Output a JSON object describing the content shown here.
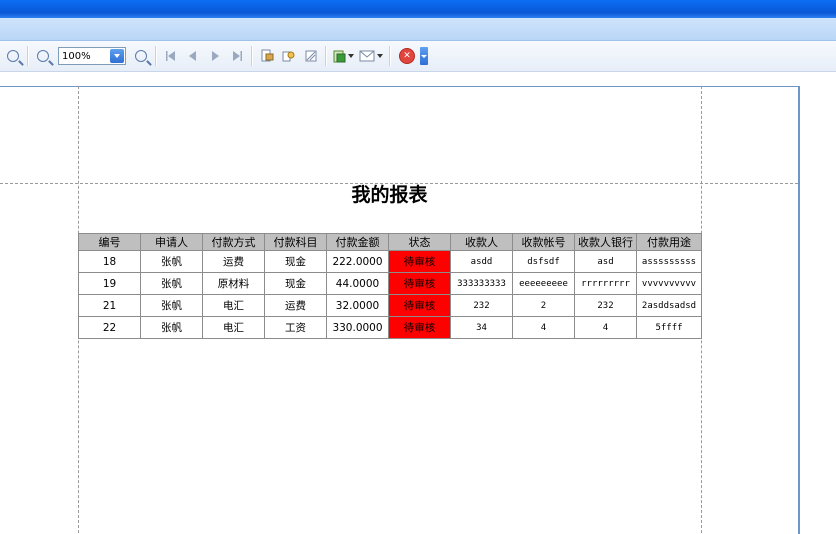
{
  "toolbar": {
    "zoom_value": "100%",
    "icons": [
      "zoom-in-icon",
      "zoom-out-icon",
      "zoom-in-icon",
      "first-page-icon",
      "prev-page-icon",
      "next-page-icon",
      "last-page-icon",
      "page-setup-icon",
      "find-icon",
      "fit-page-icon",
      "export-icon",
      "email-icon",
      "close-icon"
    ]
  },
  "report": {
    "title": "我的报表",
    "columns": [
      "编号",
      "申请人",
      "付款方式",
      "付款科目",
      "付款金额",
      "状态",
      "收款人",
      "收款帐号",
      "收款人银行",
      "付款用途"
    ],
    "rows": [
      [
        "18",
        "张帆",
        "运费",
        "现金",
        "222.0000",
        "待审核",
        "asdd",
        "dsfsdf",
        "asd",
        "asssssssss"
      ],
      [
        "19",
        "张帆",
        "原材料",
        "现金",
        "44.0000",
        "待审核",
        "333333333",
        "eeeeeeeee",
        "rrrrrrrrr",
        "vvvvvvvvvv"
      ],
      [
        "21",
        "张帆",
        "电汇",
        "运费",
        "32.0000",
        "待审核",
        "232",
        "2",
        "232",
        "2asddsadsd"
      ],
      [
        "22",
        "张帆",
        "电汇",
        "工资",
        "330.0000",
        "待审核",
        "34",
        "4",
        "4",
        "5ffff"
      ]
    ],
    "status_color": "#ff0000",
    "header_color": "#bfbfbf"
  }
}
